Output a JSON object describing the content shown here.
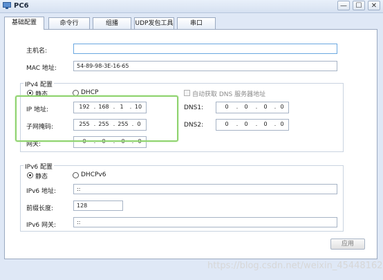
{
  "window": {
    "title": "PC6",
    "minimize_glyph": "—",
    "maximize_glyph": "☐",
    "close_glyph": "✕"
  },
  "tabs": [
    {
      "label": "基础配置",
      "active": true
    },
    {
      "label": "命令行"
    },
    {
      "label": "组播"
    },
    {
      "label": "UDP发包工具"
    },
    {
      "label": "串口"
    }
  ],
  "basic": {
    "hostname_label": "主机名:",
    "hostname_value": "",
    "mac_label": "MAC 地址:",
    "mac_value": "54-89-98-3E-16-65"
  },
  "ipv4": {
    "group_title": "IPv4 配置",
    "static_label": "静态",
    "dhcp_label": "DHCP",
    "auto_dns_label": "自动获取 DNS 服务器地址",
    "ip_label": "IP 地址:",
    "ip": [
      "192",
      "168",
      "1",
      "10"
    ],
    "mask_label": "子网掩码:",
    "mask": [
      "255",
      "255",
      "255",
      "0"
    ],
    "gateway_label": "网关:",
    "gateway": [
      "0",
      "0",
      "0",
      "0"
    ],
    "dns1_label": "DNS1:",
    "dns1": [
      "0",
      "0",
      "0",
      "0"
    ],
    "dns2_label": "DNS2:",
    "dns2": [
      "0",
      "0",
      "0",
      "0"
    ]
  },
  "ipv6": {
    "group_title": "IPv6 配置",
    "static_label": "静态",
    "dhcpv6_label": "DHCPv6",
    "address_label": "IPv6 地址:",
    "address_value": "::",
    "prefix_label": "前缀长度:",
    "prefix_value": "128",
    "gateway_label": "IPv6 网关:",
    "gateway_value": "::"
  },
  "apply_label": "应用",
  "watermark": "https://blog.csdn.net/weixin_45448162",
  "colors": {
    "highlight": "#8fd36f",
    "focus": "#6aa7e0",
    "panel": "#ffffff",
    "chrome": "#dfe8f6"
  }
}
